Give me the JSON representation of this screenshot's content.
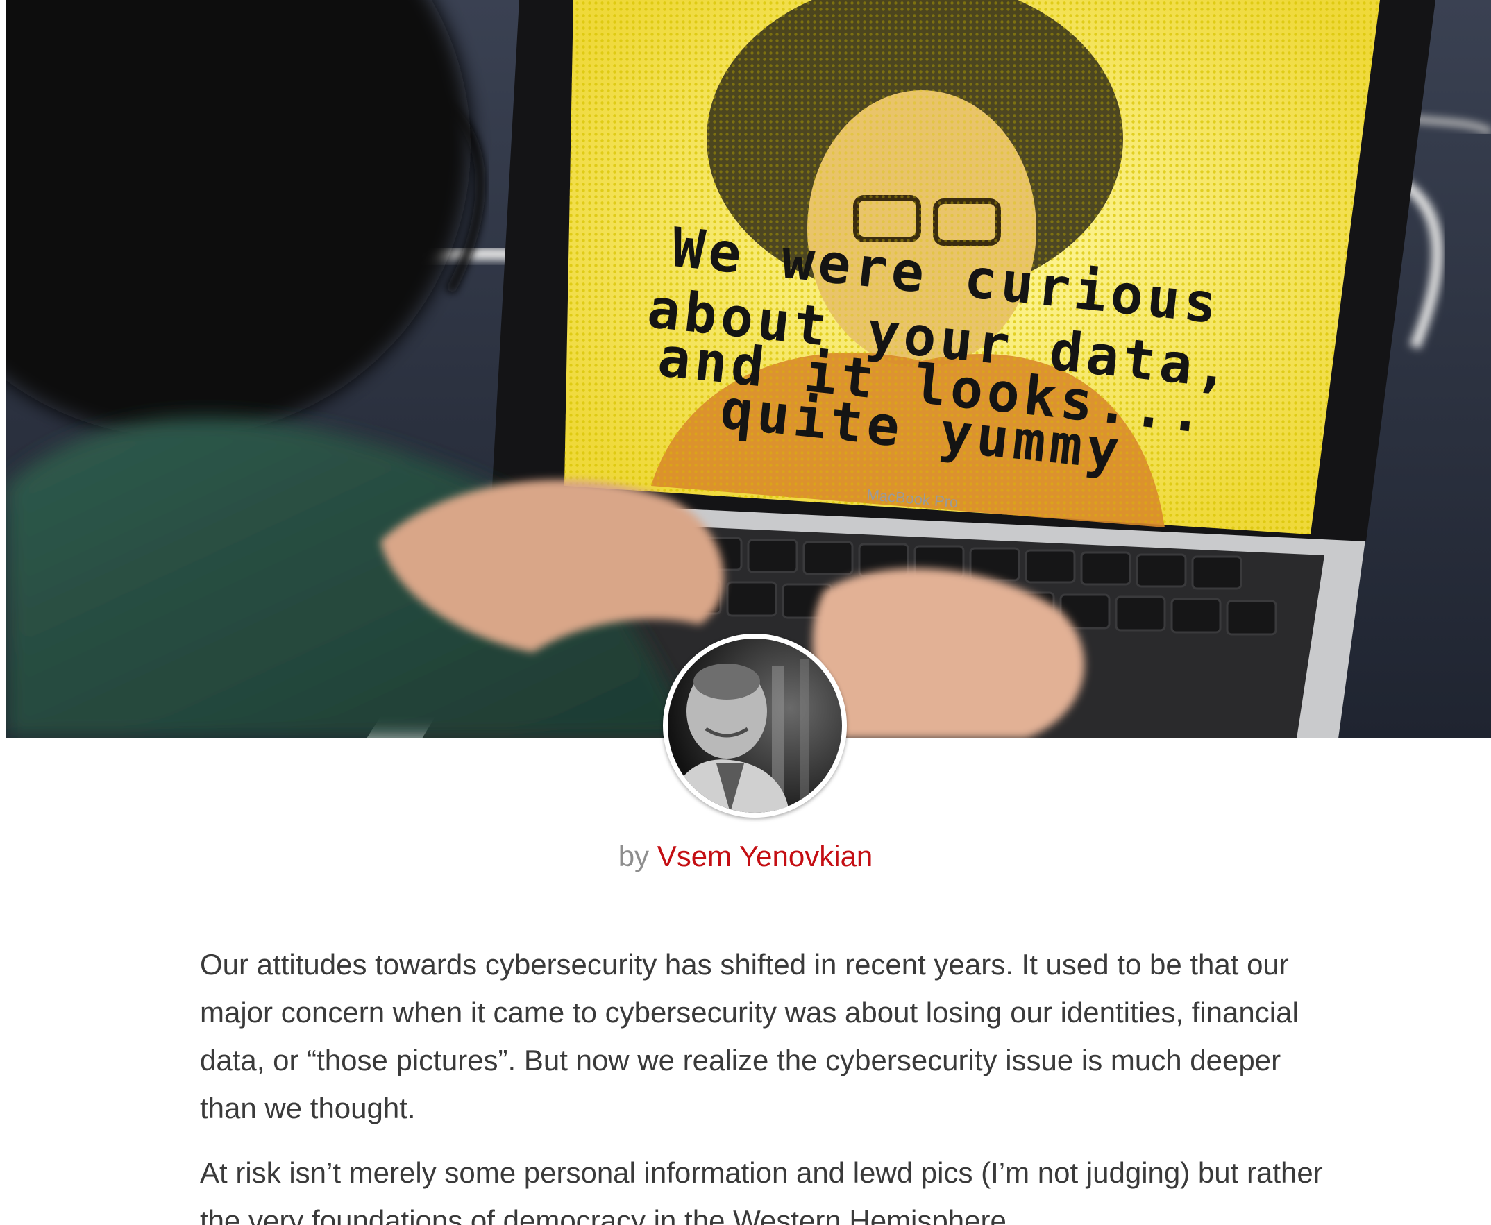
{
  "hero": {
    "screen_text_lines": [
      "We were curious",
      "about your data,",
      "and it looks...",
      "quite yummy"
    ],
    "laptop_brand_label": "MacBook Pro"
  },
  "author": {
    "by_prefix": "by",
    "name": "Vsem Yenovkian"
  },
  "article": {
    "paragraphs": [
      "Our attitudes towards cybersecurity has shifted in recent years. It used to be that our major concern when it came to cybersecurity was about losing our identities, financial data, or “those pictures”. But now we realize the cybersecurity issue is much deeper than we thought.",
      "At risk isn’t merely some personal information and lewd pics (I’m not judging) but rather the very foundations of democracy in the Western Hemisphere."
    ]
  },
  "colors": {
    "author_link": "#c40e13",
    "byline_prefix": "#8e8e8e",
    "body_text": "#3a3a3a",
    "screen_yellow": "#f4e64a"
  }
}
